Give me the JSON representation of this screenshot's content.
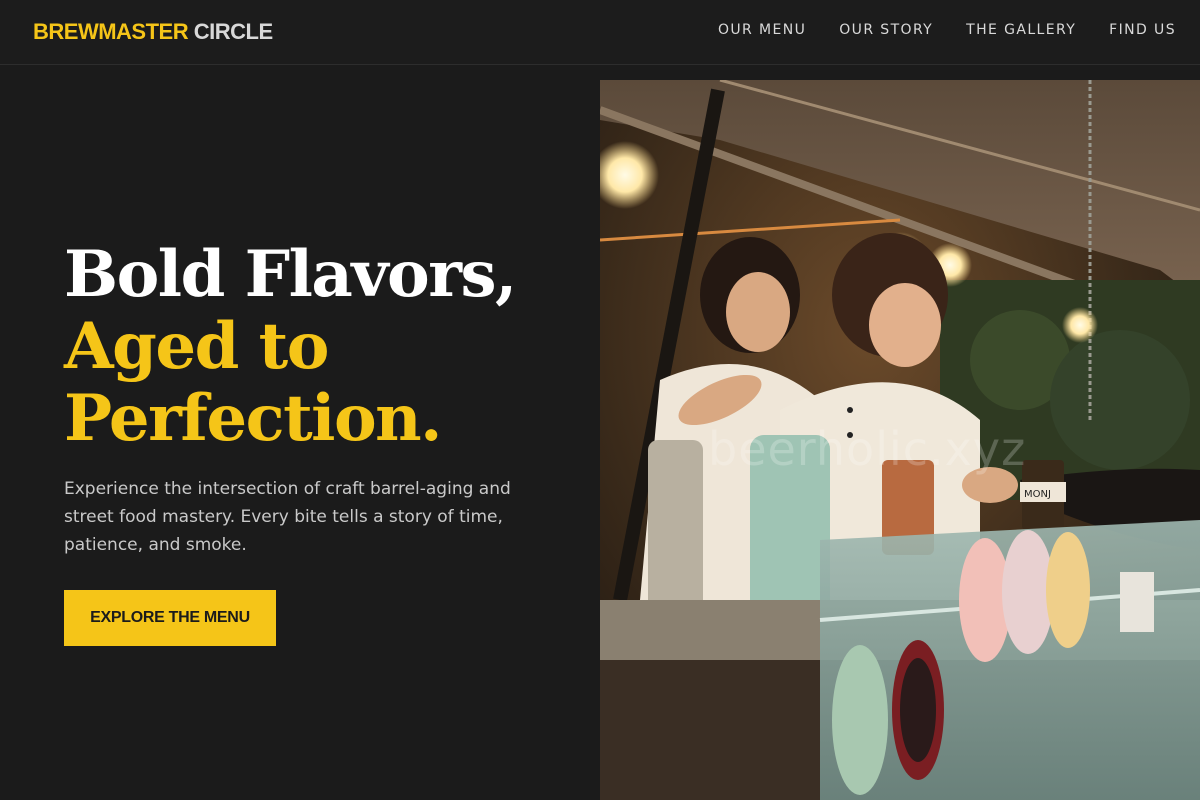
{
  "header": {
    "logo_brand": "BREWMASTER",
    "logo_rest": "CIRCLE",
    "nav": [
      "OUR MENU",
      "OUR STORY",
      "THE GALLERY",
      "FIND US"
    ]
  },
  "hero": {
    "headline_line1": "Bold Flavors,",
    "headline_line2": "Aged to",
    "headline_line3": "Perfection.",
    "subtitle": "Experience the intersection of craft barrel-aging and street food mastery. Every bite tells a story of time, patience, and smoke.",
    "cta_label": "EXPLORE THE MENU"
  },
  "photo": {
    "watermark": "beerholic.xyz",
    "sign_text": "MONJ"
  },
  "colors": {
    "accent": "#f5c518",
    "background": "#1b1b1b",
    "text_light": "#c9c9c9"
  }
}
